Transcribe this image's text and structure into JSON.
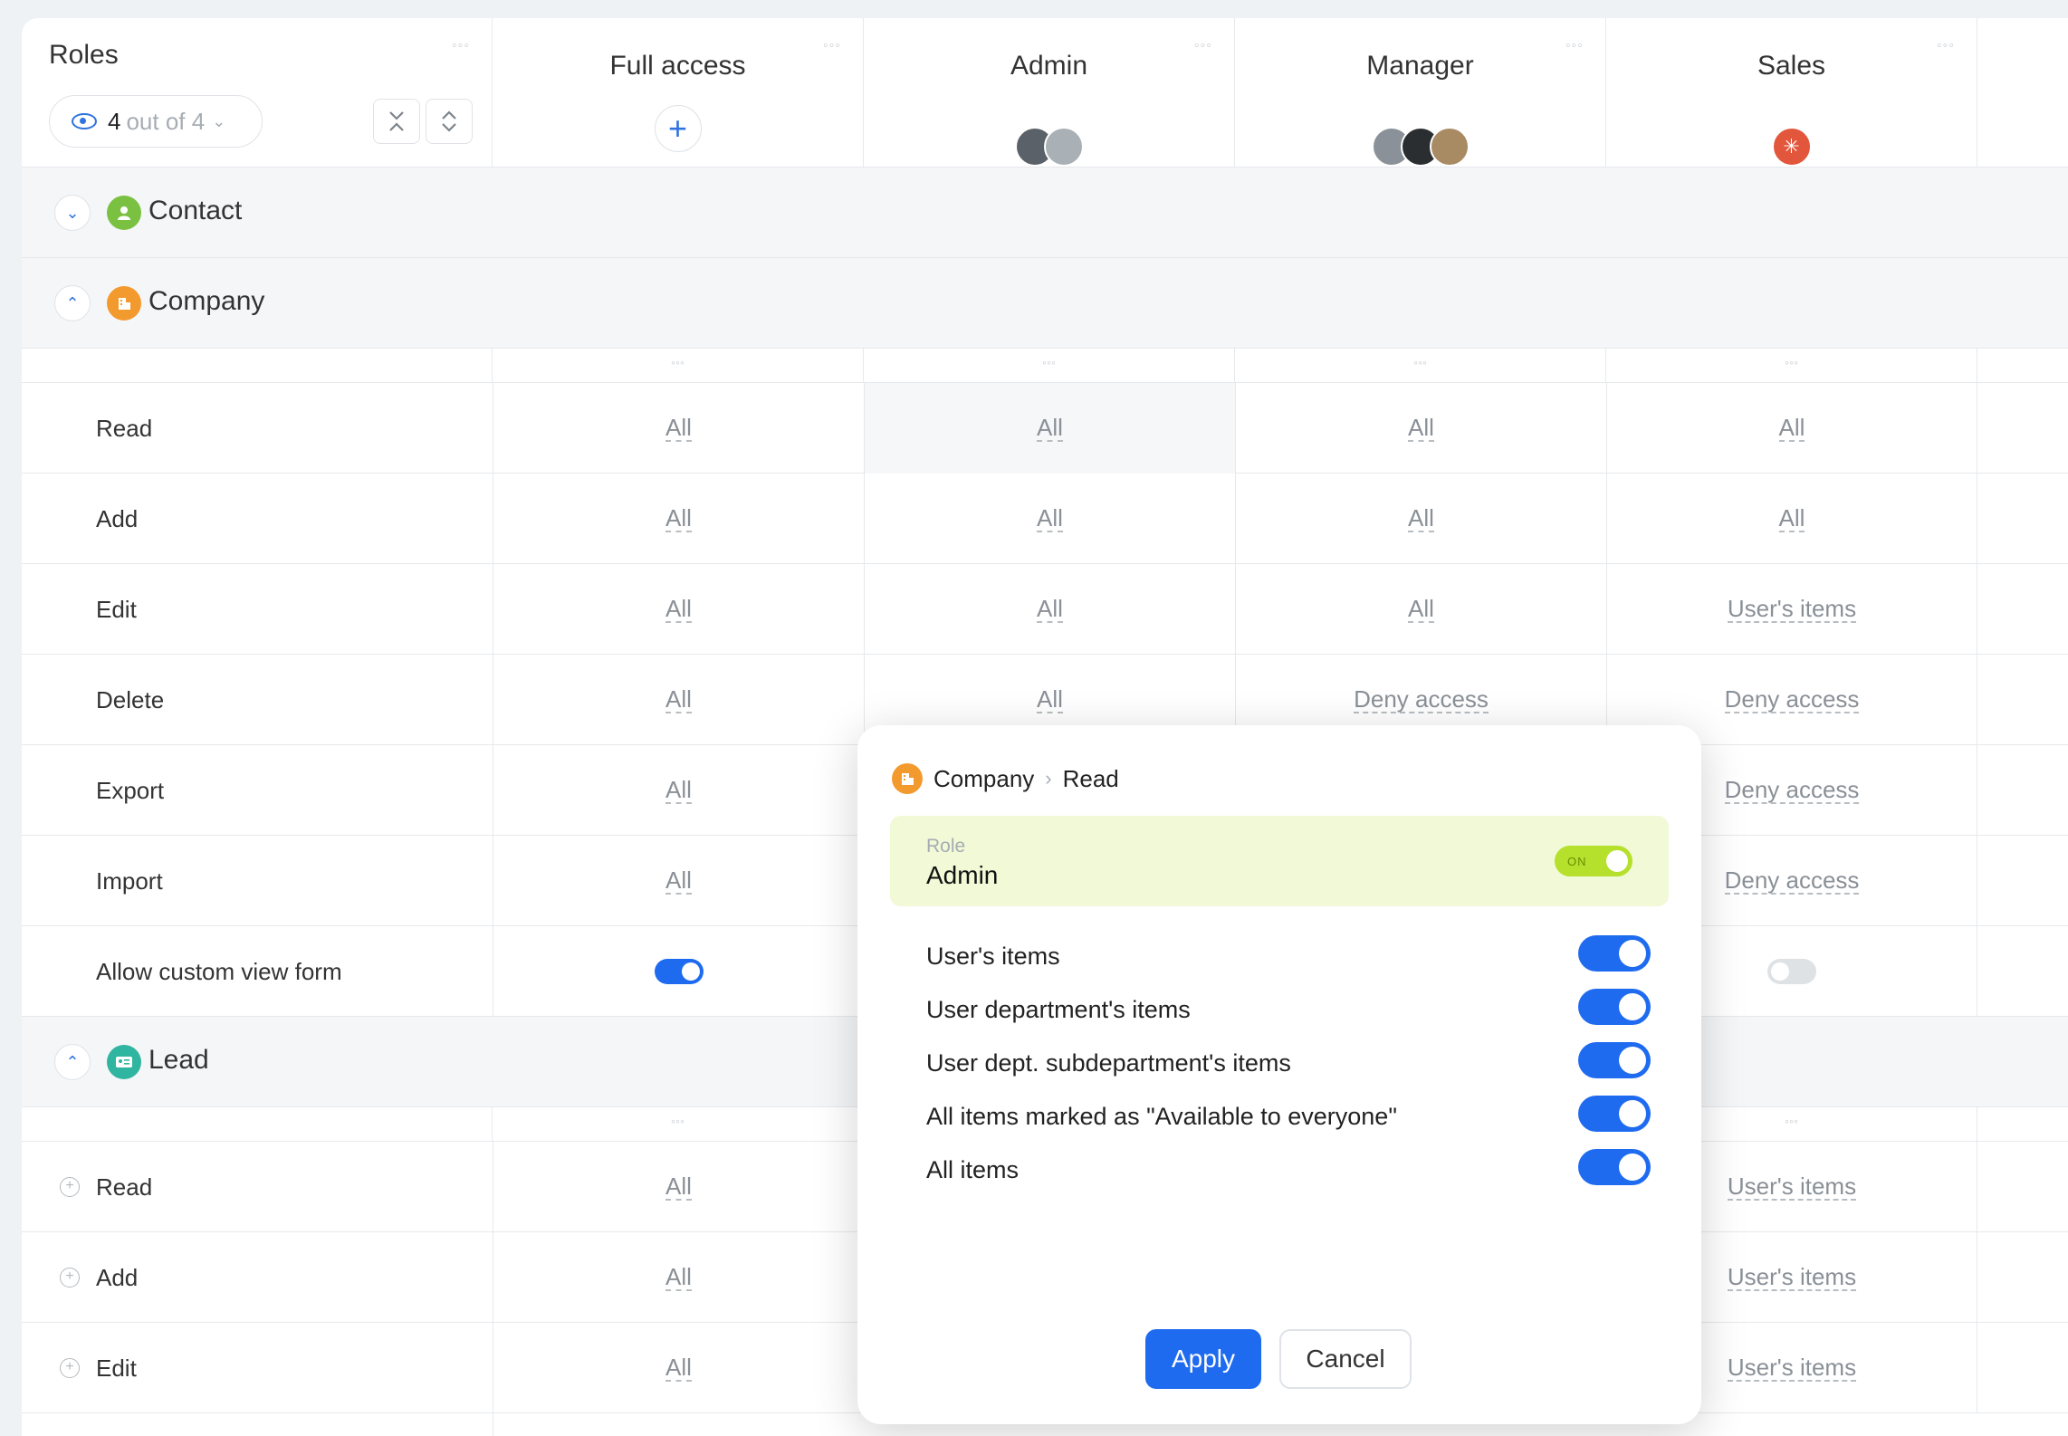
{
  "header": {
    "roles_title": "Roles",
    "filter": {
      "count": "4",
      "of_text": "out of 4"
    },
    "columns": [
      {
        "title": "Full access"
      },
      {
        "title": "Admin"
      },
      {
        "title": "Manager"
      },
      {
        "title": "Sales"
      }
    ]
  },
  "sections": {
    "contact": {
      "label": "Contact"
    },
    "company": {
      "label": "Company"
    },
    "lead": {
      "label": "Lead"
    }
  },
  "company_rows": [
    {
      "label": "Read",
      "values": [
        "All",
        "All",
        "All",
        "All"
      ]
    },
    {
      "label": "Add",
      "values": [
        "All",
        "All",
        "All",
        "All"
      ]
    },
    {
      "label": "Edit",
      "values": [
        "All",
        "All",
        "All",
        "User's items"
      ]
    },
    {
      "label": "Delete",
      "values": [
        "All",
        "All",
        "Deny access",
        "Deny access"
      ]
    },
    {
      "label": "Export",
      "values": [
        "All",
        "",
        "",
        "Deny access"
      ]
    },
    {
      "label": "Import",
      "values": [
        "All",
        "",
        "",
        "Deny access"
      ]
    },
    {
      "label": "Allow custom view form",
      "toggles": [
        "on",
        "",
        "",
        "off"
      ]
    }
  ],
  "lead_rows": [
    {
      "label": "Read",
      "values": [
        "All",
        "",
        "",
        "User's items"
      ]
    },
    {
      "label": "Add",
      "values": [
        "All",
        "",
        "",
        "User's items"
      ]
    },
    {
      "label": "Edit",
      "values": [
        "All",
        "",
        "",
        "User's items"
      ]
    }
  ],
  "popup": {
    "breadcrumb": {
      "entity": "Company",
      "action": "Read"
    },
    "role_label": "Role",
    "role_value": "Admin",
    "role_switch_text": "ON",
    "options": [
      {
        "label": "User's items",
        "on": true
      },
      {
        "label": "User department's items",
        "on": true
      },
      {
        "label": "User dept. subdepartment's items",
        "on": true
      },
      {
        "label": "All items marked as \"Available to everyone\"",
        "on": true
      },
      {
        "label": "All items",
        "on": true
      }
    ],
    "apply_label": "Apply",
    "cancel_label": "Cancel"
  },
  "colors": {
    "accent": "#1f6bf0",
    "contact_icon": "#7ac142",
    "company_icon": "#f39a2e",
    "lead_icon": "#2fb5a0",
    "sales_avatar": "#e2563b"
  }
}
